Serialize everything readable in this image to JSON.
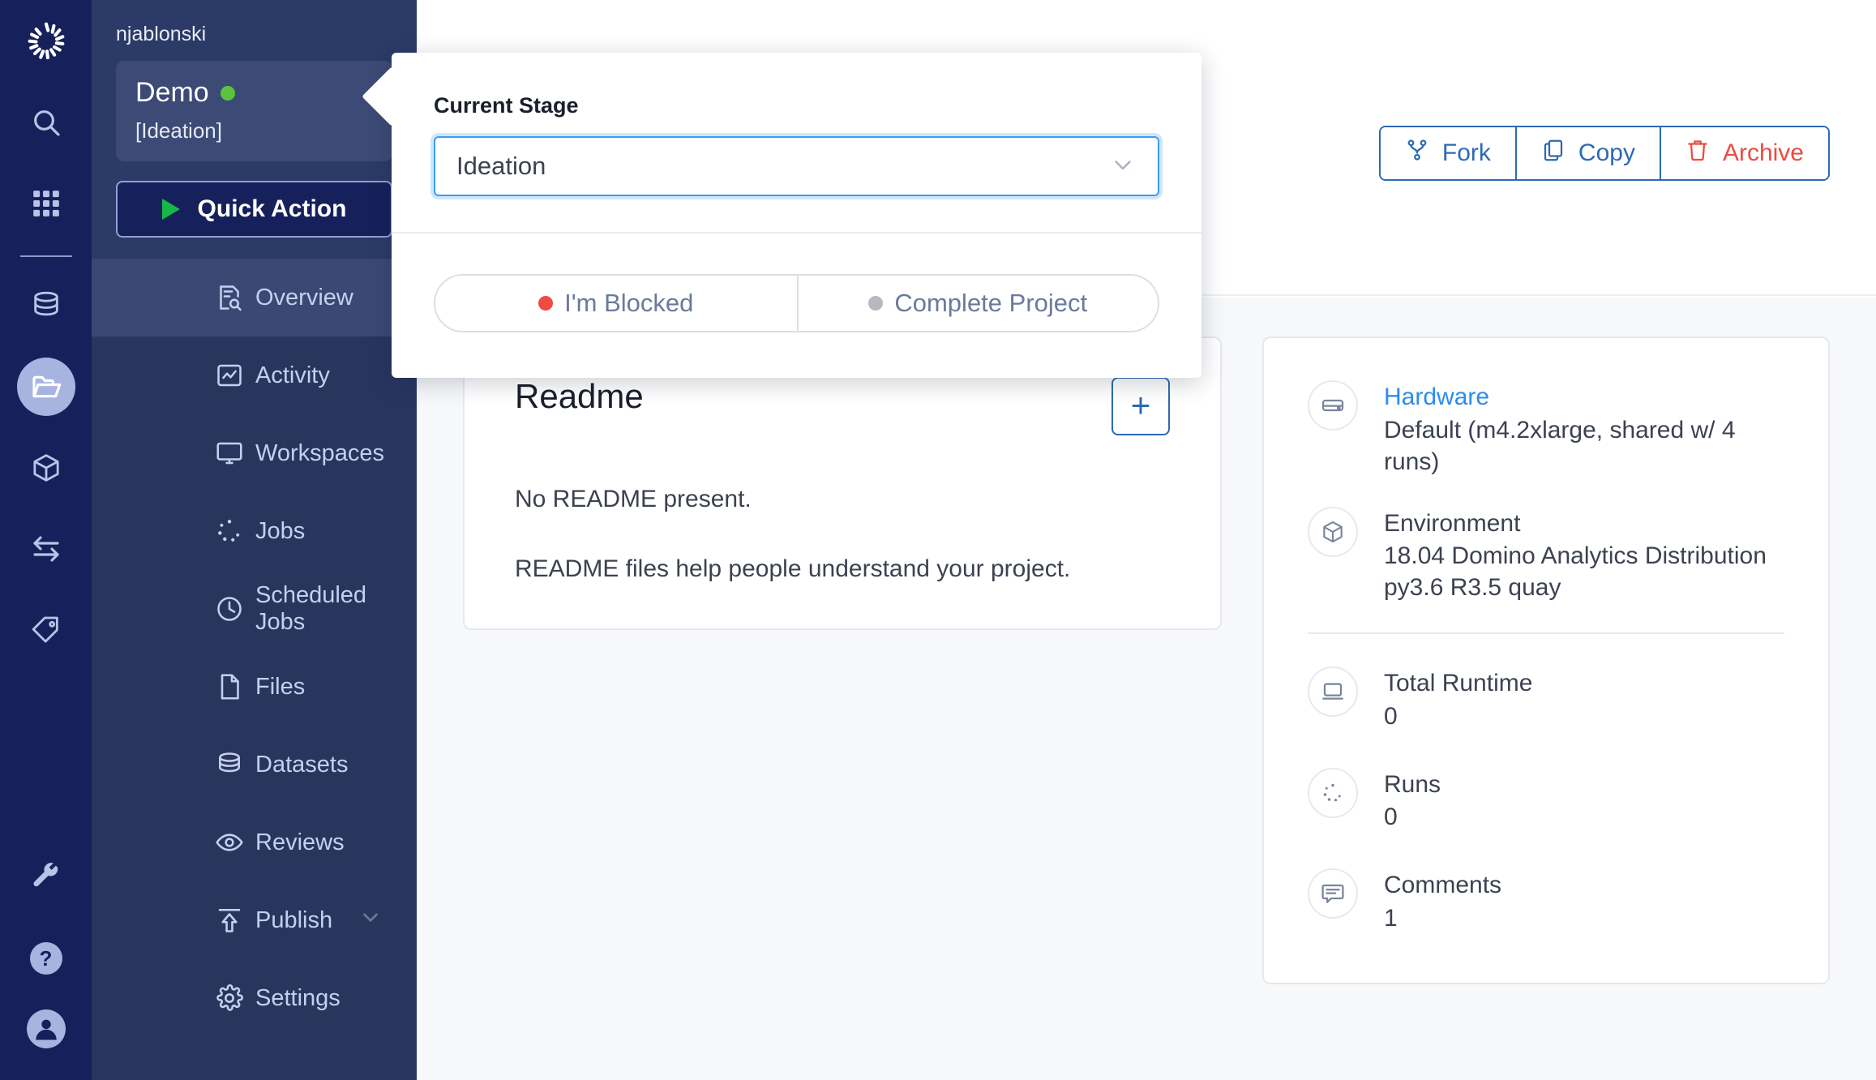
{
  "rail": {
    "logo_icon": "domino-logo-icon",
    "items": [
      {
        "icon": "search-icon",
        "name": "search",
        "active": false
      },
      {
        "icon": "grid-apps-icon",
        "name": "apps",
        "active": false
      },
      {
        "icon": "database-icon",
        "name": "data",
        "active": false
      },
      {
        "icon": "folder-open-icon",
        "name": "projects",
        "active": true
      },
      {
        "icon": "cube-icon",
        "name": "environments",
        "active": false
      },
      {
        "icon": "transfer-arrows-icon",
        "name": "transfer",
        "active": false
      },
      {
        "icon": "tag-icon",
        "name": "tags",
        "active": false
      }
    ],
    "bottom_items": [
      {
        "icon": "wrench-icon",
        "name": "admin"
      },
      {
        "icon": "help-icon",
        "name": "help",
        "glyph": "?"
      },
      {
        "icon": "user-avatar-icon",
        "name": "account"
      }
    ]
  },
  "sidebar": {
    "owner": "njablonski",
    "project_name": "Demo",
    "project_status_color": "#5cc43c",
    "project_stage": "[Ideation]",
    "quick_action_label": "Quick Action",
    "nav_items": [
      {
        "label": "Overview",
        "icon": "overview-doc-search-icon",
        "active": true,
        "chevron": false
      },
      {
        "label": "Activity",
        "icon": "activity-chart-icon",
        "active": false,
        "chevron": false
      },
      {
        "label": "Workspaces",
        "icon": "monitor-icon",
        "active": false,
        "chevron": false
      },
      {
        "label": "Jobs",
        "icon": "spinner-dots-icon",
        "active": false,
        "chevron": false
      },
      {
        "label": "Scheduled Jobs",
        "icon": "clock-icon",
        "active": false,
        "chevron": false
      },
      {
        "label": "Files",
        "icon": "file-icon",
        "active": false,
        "chevron": false
      },
      {
        "label": "Datasets",
        "icon": "database-icon",
        "active": false,
        "chevron": false
      },
      {
        "label": "Reviews",
        "icon": "eye-icon",
        "active": false,
        "chevron": false
      },
      {
        "label": "Publish",
        "icon": "upload-icon",
        "active": false,
        "chevron": true
      },
      {
        "label": "Settings",
        "icon": "gear-icon",
        "active": false,
        "chevron": false
      }
    ]
  },
  "header": {
    "actions": [
      {
        "label": "Fork",
        "icon": "fork-icon",
        "color": "#2d6ab4"
      },
      {
        "label": "Copy",
        "icon": "copy-icon",
        "color": "#2d6ab4"
      },
      {
        "label": "Archive",
        "icon": "trash-icon",
        "color": "#ed4a3e"
      }
    ]
  },
  "popover": {
    "field_label": "Current Stage",
    "selected_stage": "Ideation",
    "dropdown_icon": "chevron-down-icon",
    "segments": [
      {
        "label": "I'm Blocked",
        "dot_color": "#ef4b42"
      },
      {
        "label": "Complete Project",
        "dot_color": "#b6babf"
      }
    ]
  },
  "readme": {
    "title": "Readme",
    "add_icon": "plus-icon",
    "empty_line_1": "No README present.",
    "empty_line_2": "README files help people understand your project."
  },
  "info": {
    "rows": [
      {
        "icon": "hardware-icon",
        "label": "Hardware",
        "label_is_link": true,
        "value": "Default (m4.2xlarge, shared w/ 4 runs)"
      },
      {
        "icon": "cube-icon",
        "label": "Environment",
        "label_is_link": false,
        "value": "18.04 Domino Analytics Distribution py3.6 R3.5 quay"
      }
    ],
    "stats": [
      {
        "icon": "laptop-icon",
        "label": "Total Runtime",
        "value": "0"
      },
      {
        "icon": "spinner-dots-icon",
        "label": "Runs",
        "value": "0"
      },
      {
        "icon": "comment-icon",
        "label": "Comments",
        "value": "1"
      }
    ]
  },
  "colors": {
    "rail_bg": "#16205a",
    "sidebar_bg": "#28365e",
    "sidebar_head_bg": "#2b3a66",
    "accent_blue": "#2d6ab4",
    "link_blue": "#2b8cf0",
    "danger_red": "#ed4a3e",
    "content_bg": "#f7f8fa"
  }
}
